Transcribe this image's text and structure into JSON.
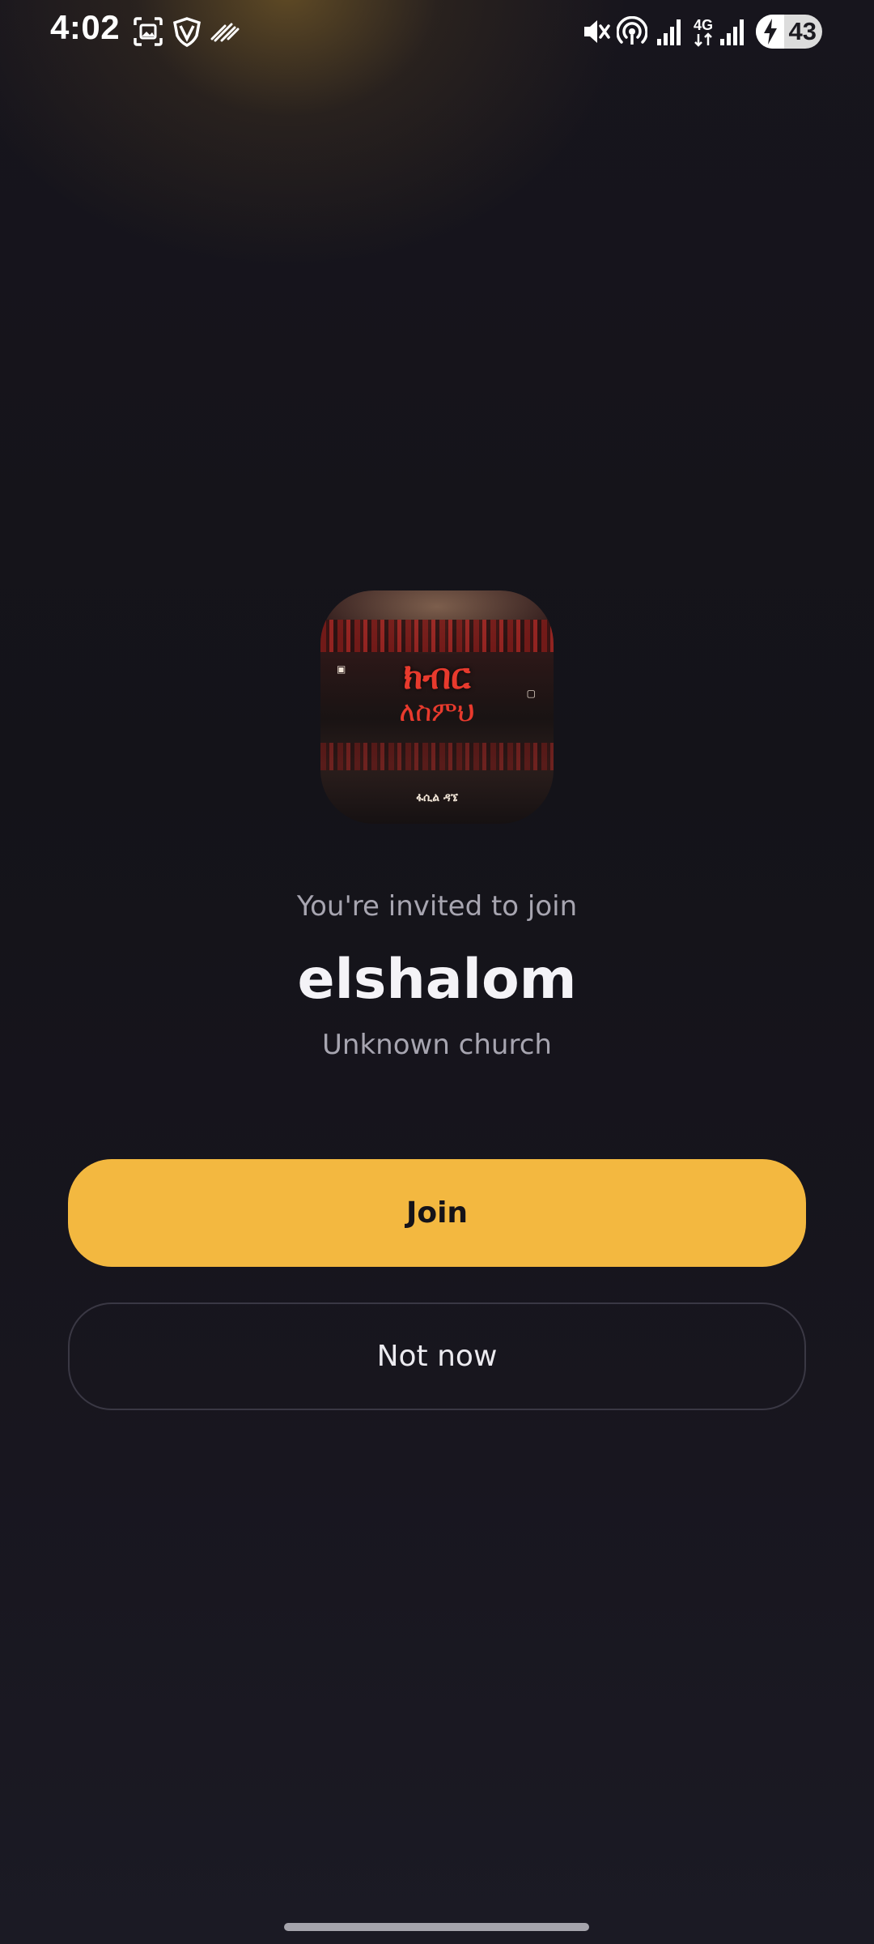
{
  "status_bar": {
    "time": "4:02",
    "battery_percent": "43",
    "network_type": "4G",
    "icons": [
      "screenshot-icon",
      "vpn-icon",
      "data-saver-icon",
      "mute-icon",
      "hotspot-icon",
      "signal-icon",
      "signal-icon",
      "battery-icon"
    ]
  },
  "group": {
    "avatar_art_title": "ክብር",
    "avatar_art_subtitle": "ለስምህ",
    "avatar_caption": "ፋሲል ዳኜ"
  },
  "invite": {
    "intro_text": "You're invited to join",
    "group_name": "elshalom",
    "church_label": "Unknown church"
  },
  "actions": {
    "join_label": "Join",
    "not_now_label": "Not now"
  },
  "colors": {
    "accent": "#f3b840",
    "background": "#17151d",
    "muted_text": "#a7a5b0"
  }
}
